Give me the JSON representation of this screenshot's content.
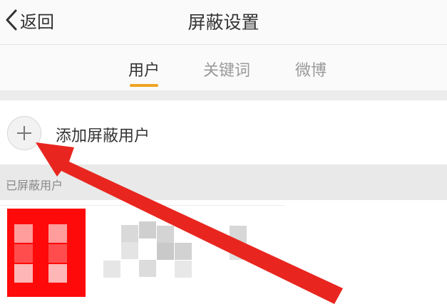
{
  "header": {
    "back_label": "返回",
    "title": "屏蔽设置"
  },
  "tabs": [
    {
      "label": "用户",
      "active": true
    },
    {
      "label": "关键词",
      "active": false
    },
    {
      "label": "微博",
      "active": false
    }
  ],
  "add_row": {
    "label": "添加屏蔽用户"
  },
  "blocked_section": {
    "title": "已屏蔽用户"
  },
  "colors": {
    "accent": "#f0a322",
    "annotation_arrow": "#e8261f",
    "avatar": "#ff0a0a"
  },
  "icons": {
    "back": "chevron-left-icon",
    "add": "plus-icon"
  }
}
